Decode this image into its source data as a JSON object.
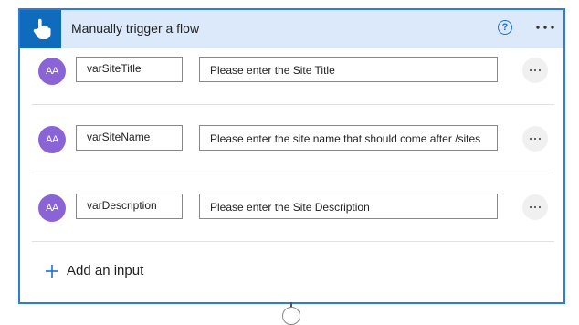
{
  "trigger": {
    "title": "Manually trigger a flow",
    "help_icon": "help-circle-icon",
    "help_glyph": "?",
    "menu_icon": "more-horizontal-icon",
    "accent_color": "#0f6cbd",
    "header_bg": "#dbe9fb",
    "border_color": "#2e7cd6"
  },
  "inputs": [
    {
      "type_icon": "text-input-icon",
      "type_glyph": "AA",
      "name": "varSiteTitle",
      "description": "Please enter the Site Title"
    },
    {
      "type_icon": "text-input-icon",
      "type_glyph": "AA",
      "name": "varSiteName",
      "description": "Please enter the site name that should come after /sites"
    },
    {
      "type_icon": "text-input-icon",
      "type_glyph": "AA",
      "name": "varDescription",
      "description": "Please enter the Site Description"
    }
  ],
  "add_input": {
    "label": "Add an input",
    "icon": "plus-icon"
  },
  "avatar_color": "#8a64d6"
}
